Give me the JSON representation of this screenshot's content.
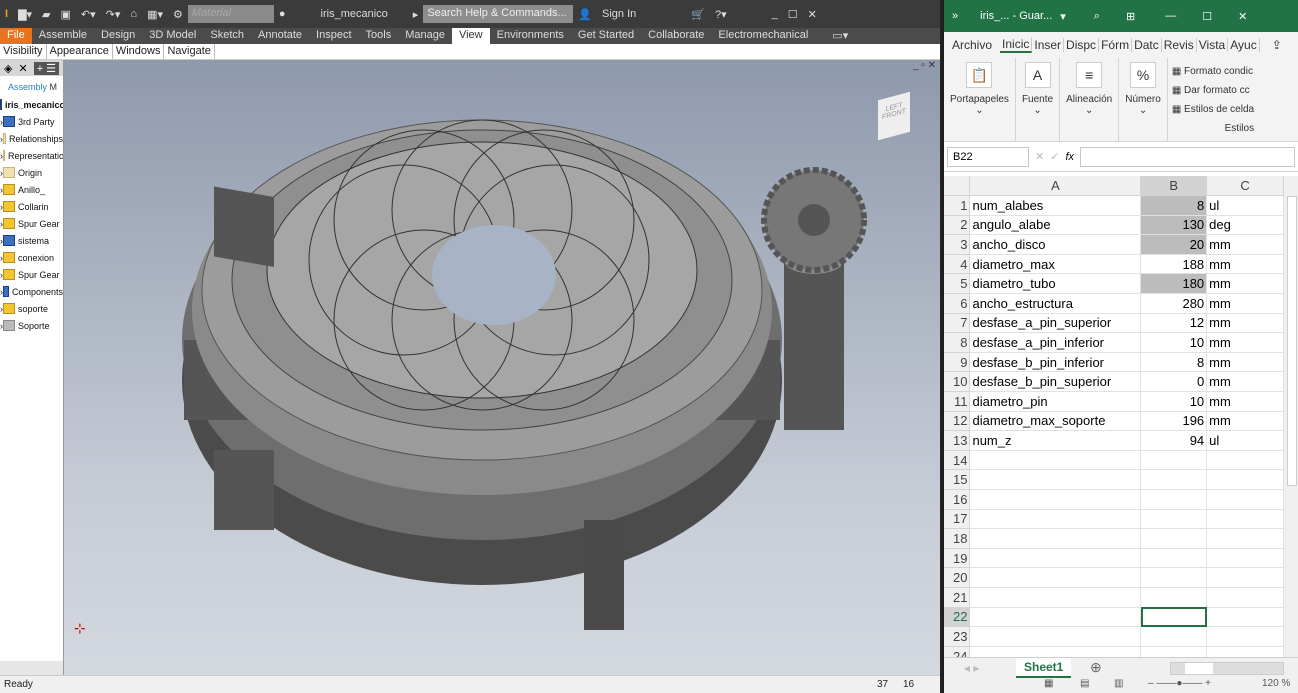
{
  "inventor": {
    "title": "iris_mecanico",
    "material_placeholder": "Material",
    "search_placeholder": "Search Help & Commands...",
    "sign_in": "Sign In",
    "tabs": [
      "File",
      "Assemble",
      "Design",
      "3D Model",
      "Sketch",
      "Annotate",
      "Inspect",
      "Tools",
      "Manage",
      "View",
      "Environments",
      "Get Started",
      "Collaborate",
      "Electromechanical"
    ],
    "active_tab": "View",
    "ribbon_panels": [
      "Visibility",
      "Appearance",
      "Windows",
      "Navigate"
    ],
    "browser": {
      "tab": "Assembly",
      "tab2": "M",
      "root": "iris_mecanico",
      "items": [
        {
          "label": "3rd Party",
          "icon": "3rd-party-icon"
        },
        {
          "label": "Relationships",
          "icon": "folder-icon"
        },
        {
          "label": "Representations",
          "icon": "representations-icon"
        },
        {
          "label": "Origin",
          "icon": "folder-icon"
        },
        {
          "label": "Anillo_",
          "icon": "part-icon"
        },
        {
          "label": "Collarin",
          "icon": "part-icon"
        },
        {
          "label": "Spur Gear",
          "icon": "part-icon"
        },
        {
          "label": "sistema",
          "icon": "assembly-icon"
        },
        {
          "label": "conexion",
          "icon": "part-icon"
        },
        {
          "label": "Spur Gear",
          "icon": "part-icon"
        },
        {
          "label": "Components",
          "icon": "components-icon"
        },
        {
          "label": "soporte",
          "icon": "part-icon"
        },
        {
          "label": "Soporte",
          "icon": "gray-part-icon"
        }
      ]
    },
    "viewcube": "LEFT FRONT",
    "status": {
      "text": "Ready",
      "n1": "37",
      "n2": "16"
    }
  },
  "excel": {
    "title": "iris_... - Guar...",
    "tabs": [
      "Archivo",
      "Inicio",
      "Insertar",
      "Disposición",
      "Fórmulas",
      "Datos",
      "Revisar",
      "Vista",
      "Ayuda"
    ],
    "tabs_shown": [
      "Archivo",
      "Inicic",
      "Inser",
      "Dispc",
      "Fórm",
      "Datc",
      "Revis",
      "Vista",
      "Ayuc"
    ],
    "groups": [
      "Portapapeles",
      "Fuente",
      "Alineación",
      "Número"
    ],
    "styles": [
      "Formato condic",
      "Dar formato cc",
      "Estilos de celda"
    ],
    "styles_group": "Estilos",
    "name_box": "B22",
    "columns": [
      "A",
      "B",
      "C"
    ],
    "rows": [
      [
        "num_alabes",
        "8",
        "ul"
      ],
      [
        "angulo_alabe",
        "130",
        "deg"
      ],
      [
        "ancho_disco",
        "20",
        "mm"
      ],
      [
        "diametro_max",
        "188",
        "mm"
      ],
      [
        "diametro_tubo",
        "180",
        "mm"
      ],
      [
        "ancho_estructura",
        "280",
        "mm"
      ],
      [
        "desfase_a_pin_superior",
        "12",
        "mm"
      ],
      [
        "desfase_a_pin_inferior",
        "10",
        "mm"
      ],
      [
        "desfase_b_pin_inferior",
        "8",
        "mm"
      ],
      [
        "desfase_b_pin_superior",
        "0",
        "mm"
      ],
      [
        "diametro_pin",
        "10",
        "mm"
      ],
      [
        "diametro_max_soporte",
        "196",
        "mm"
      ],
      [
        "num_z",
        "94",
        "ul"
      ],
      [
        "",
        "",
        ""
      ],
      [
        "",
        "",
        ""
      ],
      [
        "",
        "",
        ""
      ],
      [
        "",
        "",
        ""
      ],
      [
        "",
        "",
        ""
      ],
      [
        "",
        "",
        ""
      ],
      [
        "",
        "",
        ""
      ],
      [
        "",
        "",
        ""
      ],
      [
        "",
        "",
        ""
      ],
      [
        "",
        "",
        ""
      ],
      [
        "",
        "",
        ""
      ]
    ],
    "shaded_rows": [
      1,
      2,
      3,
      5
    ],
    "selected_cell": "B22",
    "sheet": "Sheet1",
    "zoom": "120 %",
    "accent": "#217346"
  }
}
